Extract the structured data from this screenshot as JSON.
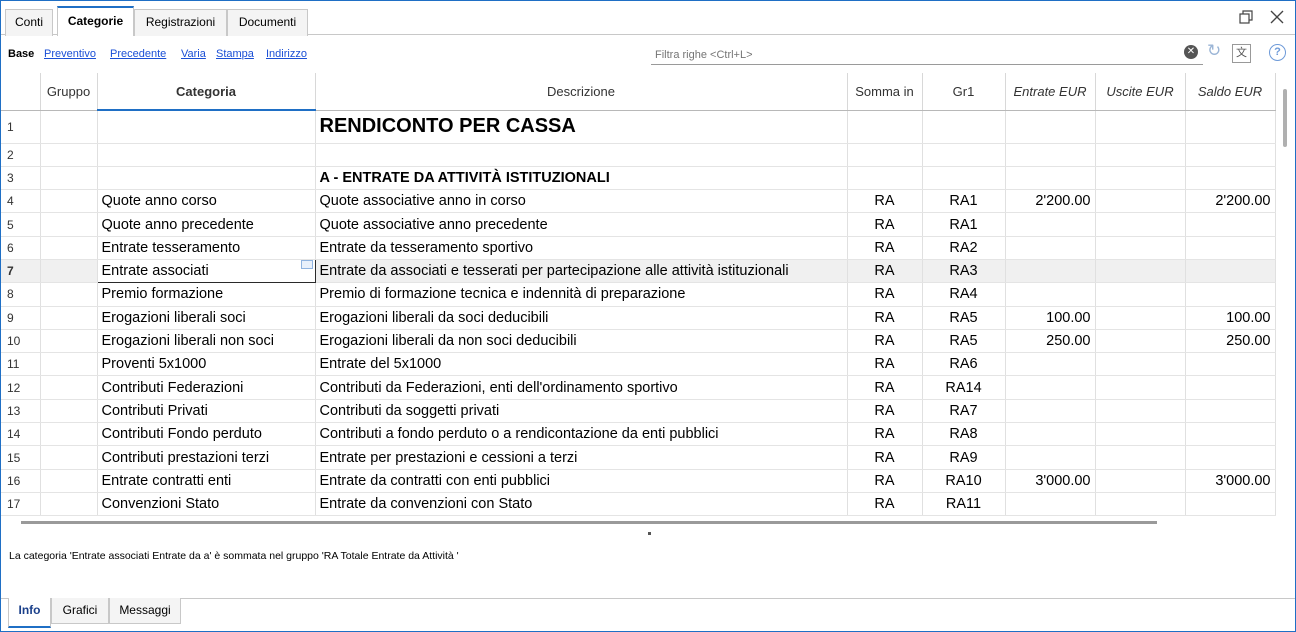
{
  "tabs": [
    "Conti",
    "Categorie",
    "Registrazioni",
    "Documenti"
  ],
  "subnav": [
    "Base",
    "Preventivo",
    "Precedente",
    "Varia",
    "Stampa",
    "Indirizzo"
  ],
  "filter": {
    "placeholder": "Filtra righe <Ctrl+L>"
  },
  "icons": {
    "restore": "restore-window-icon",
    "close": "close-icon",
    "clear": "clear-filter-icon",
    "refresh": "refresh-icon",
    "lang": "language-icon",
    "help": "help-icon",
    "lang_glyph": "文",
    "help_glyph": "?"
  },
  "columns": [
    "",
    "Gruppo",
    "Categoria",
    "Descrizione",
    "Somma in",
    "Gr1",
    "Entrate EUR",
    "Uscite EUR",
    "Saldo EUR"
  ],
  "rows": [
    [
      "1",
      "",
      "",
      "RENDICONTO PER CASSA",
      "",
      "",
      "",
      "",
      ""
    ],
    [
      "2",
      "",
      "",
      "",
      "",
      "",
      "",
      "",
      ""
    ],
    [
      "3",
      "",
      "",
      "A - ENTRATE DA ATTIVITÀ ISTITUZIONALI",
      "",
      "",
      "",
      "",
      ""
    ],
    [
      "4",
      "",
      "Quote anno corso",
      "Quote associative anno in corso",
      "RA",
      "RA1",
      "2'200.00",
      "",
      "2'200.00"
    ],
    [
      "5",
      "",
      "Quote anno precedente",
      "Quote associative anno precedente",
      "RA",
      "RA1",
      "",
      "",
      ""
    ],
    [
      "6",
      "",
      "Entrate tesseramento",
      "Entrate da tesseramento sportivo",
      "RA",
      "RA2",
      "",
      "",
      ""
    ],
    [
      "7",
      "",
      "Entrate associati",
      "Entrate da associati e tesserati per partecipazione alle attività istituzionali",
      "RA",
      "RA3",
      "",
      "",
      ""
    ],
    [
      "8",
      "",
      "Premio formazione",
      "Premio di formazione tecnica e indennità di preparazione",
      "RA",
      "RA4",
      "",
      "",
      ""
    ],
    [
      "9",
      "",
      "Erogazioni liberali soci",
      "Erogazioni liberali da soci deducibili",
      "RA",
      "RA5",
      "100.00",
      "",
      "100.00"
    ],
    [
      "10",
      "",
      "Erogazioni liberali non soci",
      "Erogazioni liberali da non soci deducibili",
      "RA",
      "RA5",
      "250.00",
      "",
      "250.00"
    ],
    [
      "11",
      "",
      "Proventi 5x1000",
      "Entrate del 5x1000",
      "RA",
      "RA6",
      "",
      "",
      ""
    ],
    [
      "12",
      "",
      "Contributi Federazioni",
      "Contributi da Federazioni, enti dell'ordinamento sportivo",
      "RA",
      "RA14",
      "",
      "",
      ""
    ],
    [
      "13",
      "",
      "Contributi Privati",
      "Contributi da soggetti privati",
      "RA",
      "RA7",
      "",
      "",
      ""
    ],
    [
      "14",
      "",
      "Contributi Fondo perduto",
      "Contributi a fondo perduto o a rendicontazione da enti pubblici",
      "RA",
      "RA8",
      "",
      "",
      ""
    ],
    [
      "15",
      "",
      "Contributi prestazioni terzi",
      "Entrate per prestazioni e cessioni a terzi",
      "RA",
      "RA9",
      "",
      "",
      ""
    ],
    [
      "16",
      "",
      "Entrate contratti enti",
      "Entrate da contratti con enti pubblici",
      "RA",
      "RA10",
      "3'000.00",
      "",
      "3'000.00"
    ],
    [
      "17",
      "",
      "Convenzioni Stato",
      "Entrate da convenzioni con Stato",
      "RA",
      "RA11",
      "",
      "",
      ""
    ]
  ],
  "info": {
    "text": "La categoria 'Entrate associati Entrate da a' è sommata nel gruppo 'RA Totale Entrate da Attività '"
  },
  "bottom_tabs": [
    "Info",
    "Grafici",
    "Messaggi"
  ],
  "colors": {
    "accent": "#1f6fc5",
    "link": "#1a4fd6"
  }
}
